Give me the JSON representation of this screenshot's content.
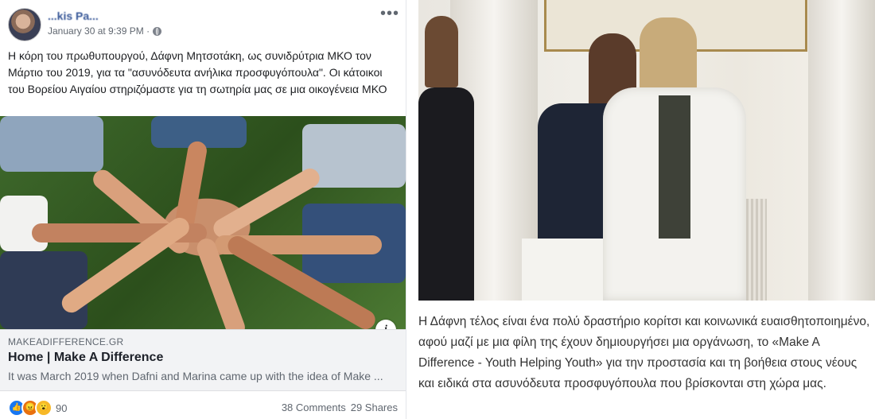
{
  "post": {
    "author": "...kis Pa...",
    "timestamp": "January 30 at 9:39 PM · ",
    "privacy_icon": "globe-icon",
    "more_icon": "•••",
    "text": "Η κόρη του πρωθυπουργού, Δάφνη Μητσοτάκη, ως συνιδρύτρια ΜΚΟ τον Μάρτιο του 2019, για τα \"ασυνόδευτα ανήλικα προσφυγόπουλα\". Οι κάτοικοι του Βορείου Αιγαίου στηριζόμαστε για τη σωτηρία μας σε μια οικογένεια ΜΚΟ",
    "link": {
      "domain": "MAKEADIFFERENCE.GR",
      "title": "Home | Make A Difference",
      "description": "It was March 2019 when Dafni and Marina came up with the idea of Make ...",
      "info_label": "i"
    },
    "reactions": {
      "icons": [
        "like-icon",
        "angry-icon",
        "wow-icon"
      ],
      "count": "90"
    },
    "comments": "38 Comments",
    "shares": "29 Shares"
  },
  "article": {
    "caption": "Η Δάφνη τέλος είναι ένα πολύ δραστήριο κορίτσι και κοινωνικά ευαισθητοποιημένο, αφού μαζί με μια φίλη της έχουν δημιουργήσει μια οργάνωση, το «Make A Difference - Youth Helping Youth» για την προστασία και τη βοήθεια στους νέους και ειδικά στα ασυνόδευτα προσφυγόπουλα που βρίσκονται στη χώρα μας."
  },
  "colors": {
    "fb_link_blue": "#385898",
    "like_blue": "#1877f2",
    "angry_orange": "#e9710f",
    "wow_yellow": "#f7b928"
  }
}
